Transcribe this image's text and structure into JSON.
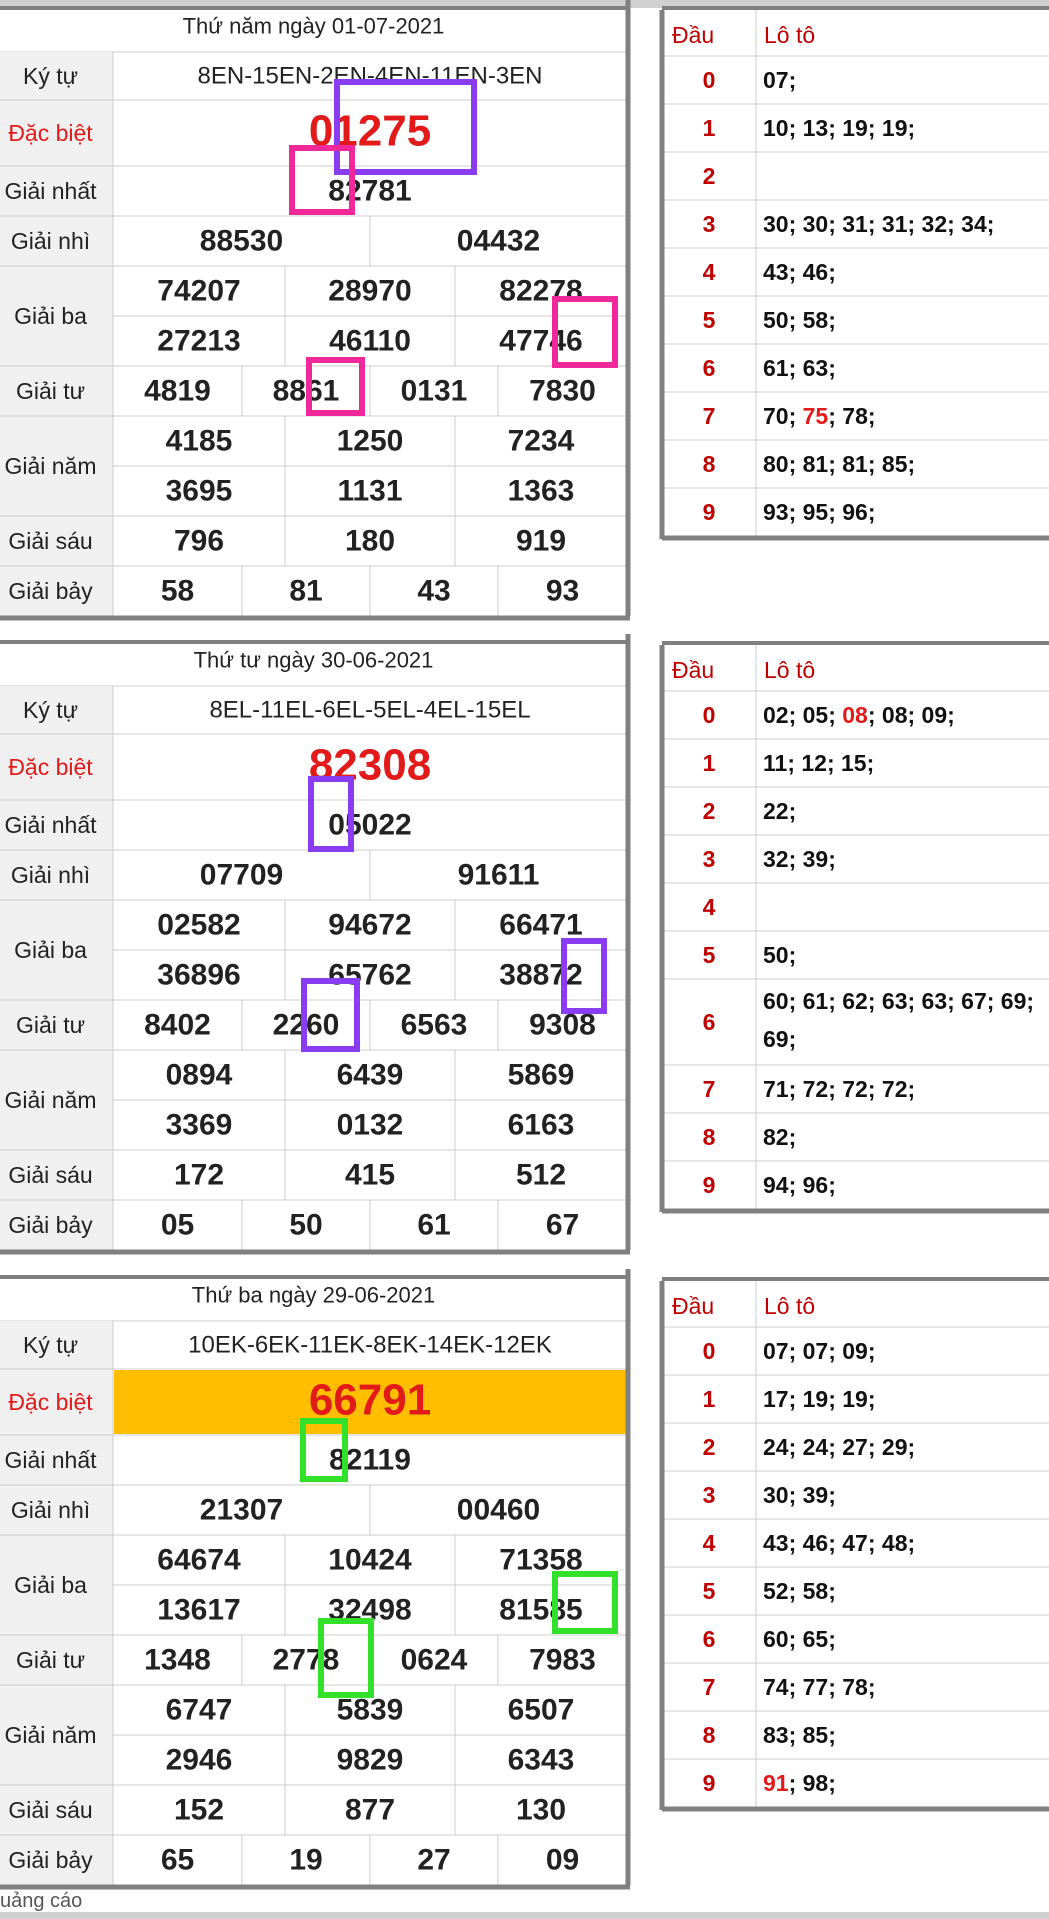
{
  "labels": {
    "ky_tu": "Ký tự",
    "dac_biet": "Đặc biệt",
    "giai_nhat": "Giải nhất",
    "giai_nhi": "Giải nhì",
    "giai_ba": "Giải ba",
    "giai_tu": "Giải tư",
    "giai_nam": "Giải năm",
    "giai_sau": "Giải sáu",
    "giai_bay": "Giải bảy",
    "dau": "Đầu",
    "loto": "Lô tô"
  },
  "footer": {
    "ad": "uảng cáo"
  },
  "colors": {
    "red": "#e21a1a",
    "dark_red": "#c00000",
    "highlight_bg": "#ffbf00",
    "purple": "#8a3cf0",
    "pink": "#f0289a",
    "green": "#33e02a"
  },
  "draws": [
    {
      "title": "Thứ năm ngày 01-07-2021",
      "ky_tu": "8EN-15EN-2EN-4EN-11EN-3EN",
      "dac_biet": "01275",
      "dac_biet_highlight": false,
      "giai_nhat": "82781",
      "giai_nhi": [
        "88530",
        "04432"
      ],
      "giai_ba": [
        [
          "74207",
          "28970",
          "82278"
        ],
        [
          "27213",
          "46110",
          "47746"
        ]
      ],
      "giai_tu": [
        "4819",
        "8861",
        "0131",
        "7830"
      ],
      "giai_nam": [
        [
          "4185",
          "1250",
          "7234"
        ],
        [
          "3695",
          "1131",
          "1363"
        ]
      ],
      "giai_sau": [
        "796",
        "180",
        "919"
      ],
      "giai_bay": [
        "58",
        "81",
        "43",
        "93"
      ],
      "loto": [
        [
          {
            "t": "07;"
          }
        ],
        [
          {
            "t": "10; 13; 19; 19;"
          }
        ],
        [],
        [
          {
            "t": "30; 30; 31; 31; 32; 34;"
          }
        ],
        [
          {
            "t": "43; 46;"
          }
        ],
        [
          {
            "t": "50; 58;"
          }
        ],
        [
          {
            "t": "61; 63;"
          }
        ],
        [
          {
            "t": "70; "
          },
          {
            "t": "75",
            "red": true
          },
          {
            "t": "; 78;"
          }
        ],
        [
          {
            "t": "80; 81; 81; 85;"
          }
        ],
        [
          {
            "t": "93; 95; 96;"
          }
        ]
      ]
    },
    {
      "title": "Thứ tư ngày 30-06-2021",
      "ky_tu": "8EL-11EL-6EL-5EL-4EL-15EL",
      "dac_biet": "82308",
      "dac_biet_highlight": false,
      "giai_nhat": "05022",
      "giai_nhi": [
        "07709",
        "91611"
      ],
      "giai_ba": [
        [
          "02582",
          "94672",
          "66471"
        ],
        [
          "36896",
          "65762",
          "38872"
        ]
      ],
      "giai_tu": [
        "8402",
        "2260",
        "6563",
        "9308"
      ],
      "giai_nam": [
        [
          "0894",
          "6439",
          "5869"
        ],
        [
          "3369",
          "0132",
          "6163"
        ]
      ],
      "giai_sau": [
        "172",
        "415",
        "512"
      ],
      "giai_bay": [
        "05",
        "50",
        "61",
        "67"
      ],
      "loto": [
        [
          {
            "t": "02; 05; "
          },
          {
            "t": "08",
            "red": true
          },
          {
            "t": "; 08; 09;"
          }
        ],
        [
          {
            "t": "11; 12; 15;"
          }
        ],
        [
          {
            "t": "22;"
          }
        ],
        [
          {
            "t": "32; 39;"
          }
        ],
        [],
        [
          {
            "t": "50;"
          }
        ],
        [
          {
            "t": "60; 61; 62; 63; 63; 67; 69;"
          },
          {
            "t": "69;",
            "br": true
          }
        ],
        [
          {
            "t": "71; 72; 72; 72;"
          }
        ],
        [
          {
            "t": "82;"
          }
        ],
        [
          {
            "t": "94; 96;"
          }
        ]
      ]
    },
    {
      "title": "Thứ ba ngày 29-06-2021",
      "ky_tu": "10EK-6EK-11EK-8EK-14EK-12EK",
      "dac_biet": "66791",
      "dac_biet_highlight": true,
      "giai_nhat": "82119",
      "giai_nhi": [
        "21307",
        "00460"
      ],
      "giai_ba": [
        [
          "64674",
          "10424",
          "71358"
        ],
        [
          "13617",
          "32498",
          "81585"
        ]
      ],
      "giai_tu": [
        "1348",
        "2778",
        "0624",
        "7983"
      ],
      "giai_nam": [
        [
          "6747",
          "5839",
          "6507"
        ],
        [
          "2946",
          "9829",
          "6343"
        ]
      ],
      "giai_sau": [
        "152",
        "877",
        "130"
      ],
      "giai_bay": [
        "65",
        "19",
        "27",
        "09"
      ],
      "loto": [
        [
          {
            "t": "07; 07; 09;"
          }
        ],
        [
          {
            "t": "17; 19; 19;"
          }
        ],
        [
          {
            "t": "24; 24; 27; 29;"
          }
        ],
        [
          {
            "t": "30; 39;"
          }
        ],
        [
          {
            "t": "43; 46; 47; 48;"
          }
        ],
        [
          {
            "t": "52; 58;"
          }
        ],
        [
          {
            "t": "60; 65;"
          }
        ],
        [
          {
            "t": "74; 77; 78;"
          }
        ],
        [
          {
            "t": "83; 85;"
          }
        ],
        [
          {
            "t": "91",
            "red": true
          },
          {
            "t": "; 98;"
          }
        ]
      ]
    }
  ]
}
